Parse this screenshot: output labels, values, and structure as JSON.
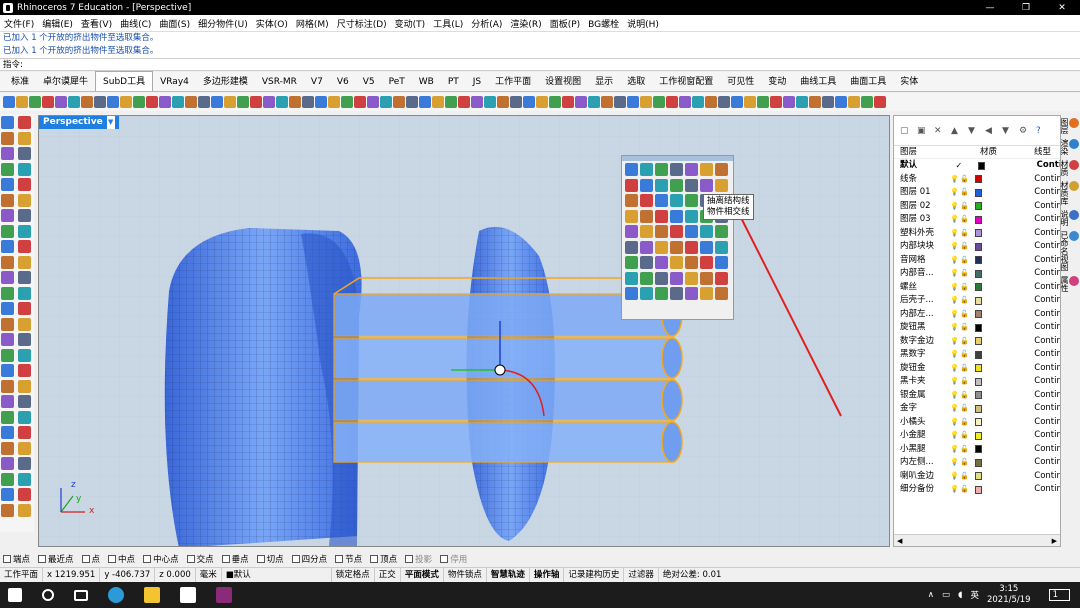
{
  "window": {
    "title": "Rhinoceros 7 Education - [Perspective]",
    "min": "—",
    "max": "❐",
    "close": "✕"
  },
  "menu": [
    "文件(F)",
    "编辑(E)",
    "查看(V)",
    "曲线(C)",
    "曲面(S)",
    "细分物件(U)",
    "实体(O)",
    "网格(M)",
    "尺寸标注(D)",
    "变动(T)",
    "工具(L)",
    "分析(A)",
    "渲染(R)",
    "面板(P)",
    "BG螺栓",
    "说明(H)"
  ],
  "history": [
    "已加入 1 个开放的挤出物件至选取集合。",
    "已加入 1 个开放的挤出物件至选取集合。"
  ],
  "command_prompt": "指令:",
  "tabs": [
    "标准",
    "卓尔谟犀牛",
    "SubD工具",
    "VRay4",
    "多边形建模",
    "VSR-MR",
    "V7",
    "V6",
    "V5",
    "PeT",
    "WB",
    "PT",
    "JS",
    "工作平面",
    "设置视图",
    "显示",
    "选取",
    "工作视窗配置",
    "可见性",
    "变动",
    "曲线工具",
    "曲面工具",
    "实体"
  ],
  "active_tab": "SubD工具",
  "viewport": {
    "label": "Perspective",
    "dropdown": "▼",
    "axis_x": "x",
    "axis_y": "y",
    "axis_z": "z"
  },
  "tooltip": {
    "line1": "抽离结构线",
    "line2": "物件相交线"
  },
  "layers": {
    "headers": {
      "name": "图层",
      "material": "材质",
      "linetype": "线型"
    },
    "rows": [
      {
        "name": "默认",
        "current": "✓",
        "color": "#000000",
        "linetype": "Conti"
      },
      {
        "name": "线条",
        "color": "#d00000",
        "linetype": "Contir"
      },
      {
        "name": "图层 01",
        "color": "#2060e0",
        "linetype": "Contir"
      },
      {
        "name": "图层 02",
        "color": "#20b020",
        "linetype": "Contir"
      },
      {
        "name": "图层 03",
        "color": "#e000c0",
        "linetype": "Contir"
      },
      {
        "name": "塑料外壳",
        "color": "#b090e0",
        "linetype": "Contir"
      },
      {
        "name": "内部块块",
        "color": "#6a4a9a",
        "linetype": "Contir"
      },
      {
        "name": "音网格",
        "color": "#203060",
        "linetype": "Contir"
      },
      {
        "name": "内部音...",
        "color": "#407060",
        "linetype": "Contir"
      },
      {
        "name": "螺丝",
        "color": "#2a7a3a",
        "linetype": "Contir"
      },
      {
        "name": "后壳子...",
        "color": "#e8e0a0",
        "linetype": "Contir"
      },
      {
        "name": "内部左...",
        "color": "#a08070",
        "linetype": "Contir"
      },
      {
        "name": "旋钮黑",
        "color": "#000000",
        "linetype": "Contir"
      },
      {
        "name": "数字金边",
        "color": "#e8d070",
        "linetype": "Contir"
      },
      {
        "name": "黑数字",
        "color": "#404040",
        "linetype": "Contir"
      },
      {
        "name": "旋钮金",
        "color": "#f0e020",
        "linetype": "Contir"
      },
      {
        "name": "黑卡夹",
        "color": "#c0c0c0",
        "linetype": "Contir"
      },
      {
        "name": "银金属",
        "color": "#909090",
        "linetype": "Contir"
      },
      {
        "name": "金字",
        "color": "#d0c080",
        "linetype": "Contir"
      },
      {
        "name": "小橘头",
        "color": "#f8f0c0",
        "linetype": "Contir"
      },
      {
        "name": "小金腿",
        "color": "#f0f020",
        "linetype": "Contir"
      },
      {
        "name": "小黑腿",
        "color": "#000000",
        "linetype": "Contir"
      },
      {
        "name": "内左侧...",
        "color": "#707040",
        "linetype": "Contir"
      },
      {
        "name": "喇叭金边",
        "color": "#e0e080",
        "linetype": "Contir"
      },
      {
        "name": "细分备份",
        "color": "#f0b0b0",
        "linetype": "Contir"
      }
    ]
  },
  "side_tabs": [
    "图层",
    "渲染",
    "材质",
    "材质库",
    "说明",
    "已命名视图",
    "属性"
  ],
  "osnaps": [
    {
      "label": "端点",
      "enabled": true
    },
    {
      "label": "最近点",
      "enabled": true
    },
    {
      "label": "点",
      "enabled": true
    },
    {
      "label": "中点",
      "enabled": true
    },
    {
      "label": "中心点",
      "enabled": true
    },
    {
      "label": "交点",
      "enabled": true
    },
    {
      "label": "垂点",
      "enabled": true
    },
    {
      "label": "切点",
      "enabled": true
    },
    {
      "label": "四分点",
      "enabled": true
    },
    {
      "label": "节点",
      "enabled": true
    },
    {
      "label": "顶点",
      "enabled": true
    },
    {
      "label": "投影",
      "enabled": false
    },
    {
      "label": "停用",
      "enabled": false
    }
  ],
  "status": {
    "cplane": "工作平面",
    "x": "x 1219.951",
    "y": "y -406.737",
    "z": "z 0.000",
    "unit": "毫米",
    "layer": "■默认",
    "toggles": [
      "锁定格点",
      "正交",
      "平面模式",
      "物件锁点",
      "智慧轨迹",
      "操作轴",
      "记录建构历史",
      "过滤器"
    ],
    "tolerance": "绝对公差: 0.01"
  },
  "taskbar": {
    "time": "3:15",
    "date": "2021/5/19",
    "ime": "英",
    "notify": "1"
  },
  "colors": {
    "accent": "#1f7fe0",
    "viewport_bg": "#c6d4e2",
    "model_blue": "#5b8cf0",
    "selection": "#f3a71d"
  }
}
